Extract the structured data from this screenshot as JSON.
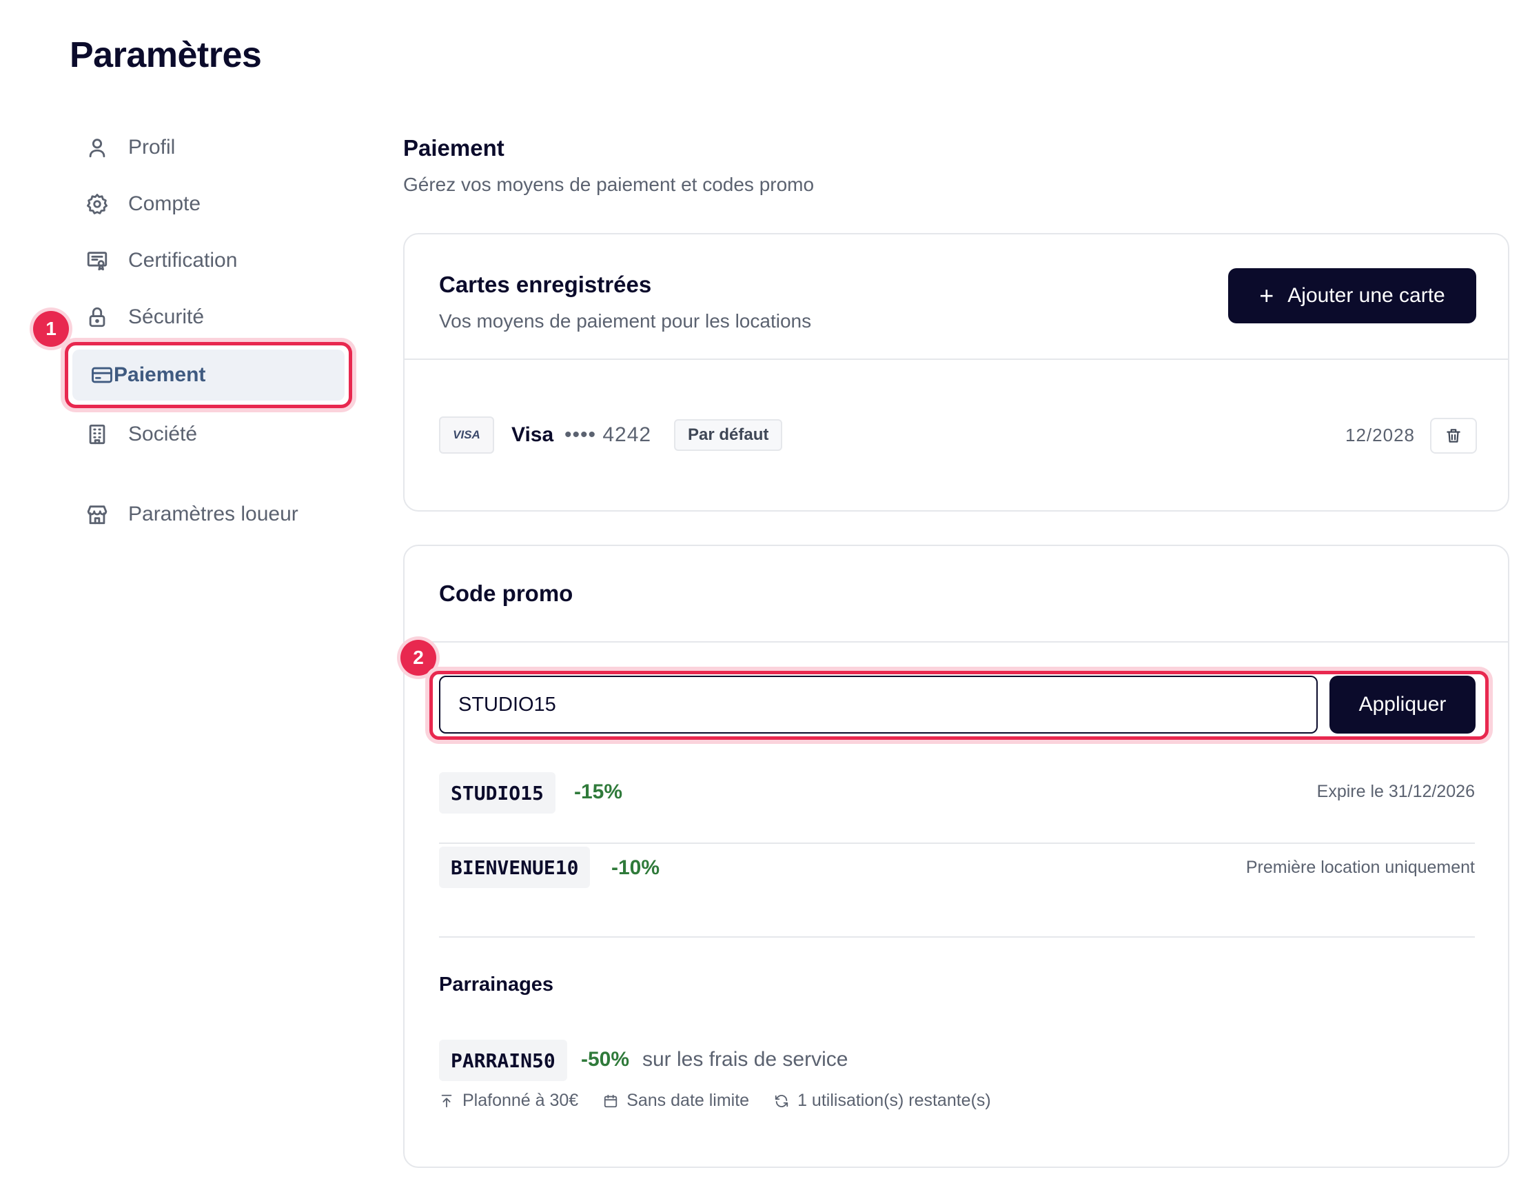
{
  "page": {
    "title": "Paramètres"
  },
  "sidebar": {
    "items": [
      {
        "label": "Profil",
        "icon": "user-icon"
      },
      {
        "label": "Compte",
        "icon": "gear-icon"
      },
      {
        "label": "Certification",
        "icon": "certificate-icon"
      },
      {
        "label": "Sécurité",
        "icon": "lock-icon"
      },
      {
        "label": "Paiement",
        "icon": "credit-card-icon",
        "active": true
      },
      {
        "label": "Société",
        "icon": "building-icon"
      },
      {
        "label": "Paramètres loueur",
        "icon": "store-icon"
      }
    ]
  },
  "annotations": {
    "step1": "1",
    "step2": "2",
    "highlight_color": "#e8284f"
  },
  "main": {
    "title": "Paiement",
    "subtitle": "Gérez vos moyens de paiement et codes promo",
    "cards_section": {
      "title": "Cartes enregistrées",
      "subtitle": "Vos moyens de paiement pour les locations",
      "add_button": "Ajouter une carte",
      "cards": [
        {
          "brand_logo": "VISA",
          "brand": "Visa",
          "masked": "•••• 4242",
          "tag": "Par défaut",
          "expiry": "12/2028"
        }
      ]
    },
    "promo_section": {
      "title": "Code promo",
      "input_value": "STUDIO15",
      "apply_button": "Appliquer",
      "codes": [
        {
          "code": "STUDIO15",
          "discount": "-15%",
          "note": "Expire le 31/12/2026"
        },
        {
          "code": "BIENVENUE10",
          "discount": "-10%",
          "note": "Première location uniquement"
        }
      ],
      "referrals": {
        "title": "Parrainages",
        "code": "PARRAIN50",
        "discount": "-50%",
        "description": "sur les frais de service",
        "meta": [
          {
            "icon": "arrow-up-to-line-icon",
            "text": "Plafonné à 30€"
          },
          {
            "icon": "calendar-icon",
            "text": "Sans date limite"
          },
          {
            "icon": "refresh-icon",
            "text": "1 utilisation(s) restante(s)"
          }
        ]
      }
    }
  },
  "colors": {
    "primary_dark": "#0b0b2b",
    "discount_green": "#2f7a3a",
    "active_nav_text": "#3f5a80"
  }
}
